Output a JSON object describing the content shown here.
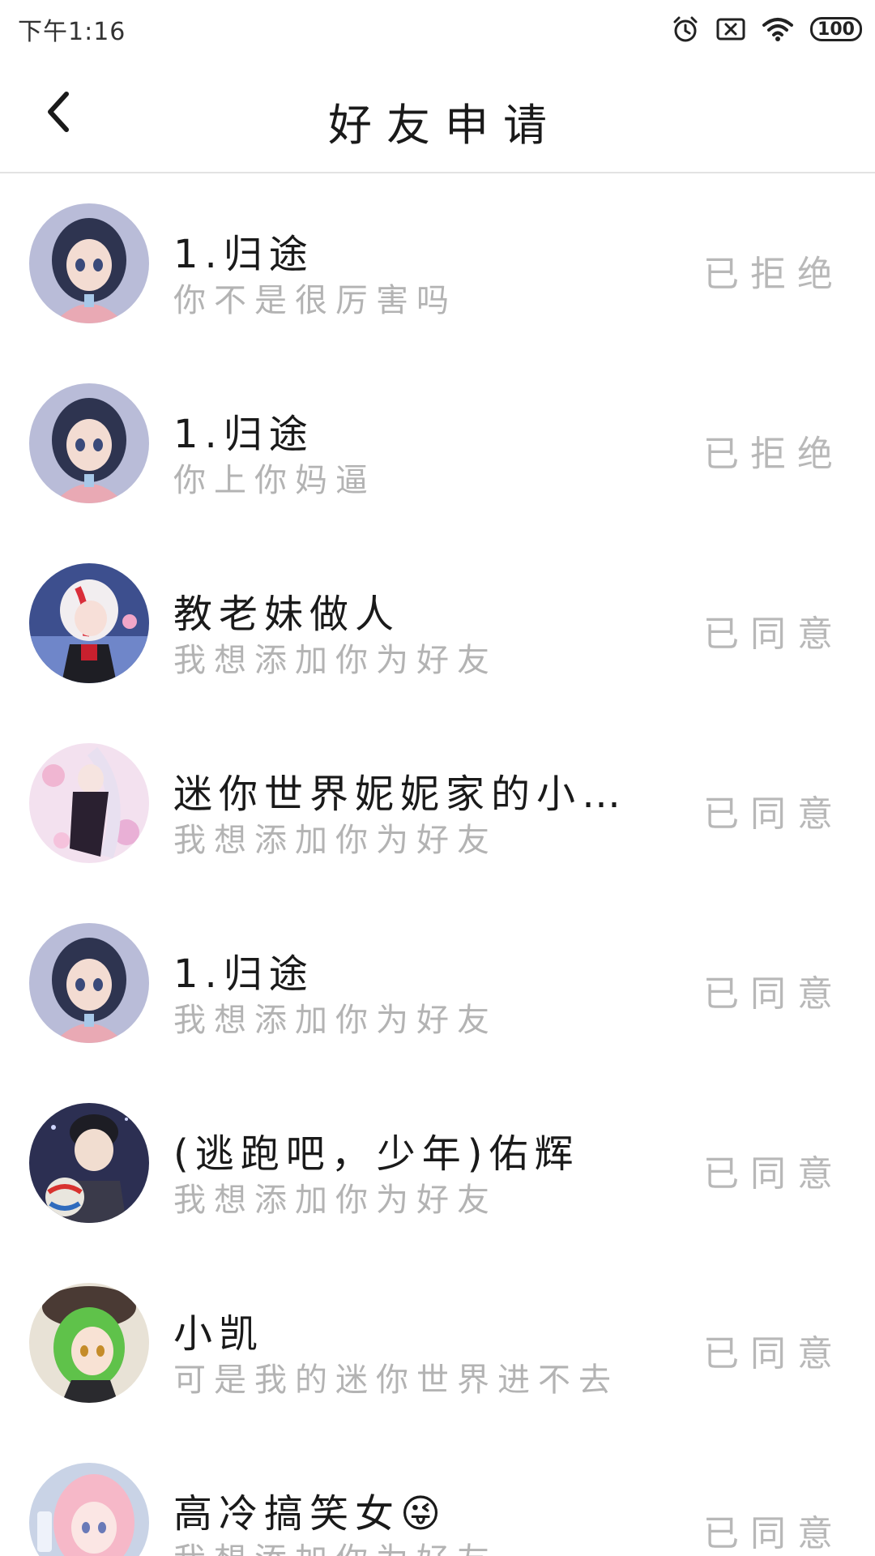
{
  "status_bar": {
    "time": "下午1:16",
    "battery": "100",
    "icons": [
      "alarm-icon",
      "no-sim-icon",
      "wifi-icon",
      "battery-icon"
    ]
  },
  "header": {
    "title": "好友申请",
    "back_icon": "chevron-left-icon"
  },
  "requests": [
    {
      "name": "1.归途",
      "message": "你不是很厉害吗",
      "status": "已拒绝",
      "avatar": "avatar-girl-blue-hair"
    },
    {
      "name": "1.归途",
      "message": "你上你妈逼",
      "status": "已拒绝",
      "avatar": "avatar-girl-blue-hair"
    },
    {
      "name": "教老妹做人",
      "message": "我想添加你为好友",
      "status": "已同意",
      "avatar": "avatar-white-red-hair"
    },
    {
      "name": "迷你世界妮妮家的小…",
      "message": "我想添加你为好友",
      "status": "已同意",
      "avatar": "avatar-pink-floral"
    },
    {
      "name": "1.归途",
      "message": "我想添加你为好友",
      "status": "已同意",
      "avatar": "avatar-girl-blue-hair"
    },
    {
      "name": "(逃跑吧，少年)佑辉",
      "message": "我想添加你为好友",
      "status": "已同意",
      "avatar": "avatar-boy-volleyball"
    },
    {
      "name": "小凯",
      "message": "可是我的迷你世界进不去",
      "status": "已同意",
      "avatar": "avatar-green-hair"
    },
    {
      "name": "高冷搞笑女😜",
      "message": "我想添加你为好友",
      "status": "已同意",
      "avatar": "avatar-pink-hair"
    }
  ],
  "colors": {
    "name_text": "#1a1a1a",
    "message_text": "#b3b3b3",
    "status_text": "#b8b8b8",
    "divider": "#e3e3e3"
  }
}
